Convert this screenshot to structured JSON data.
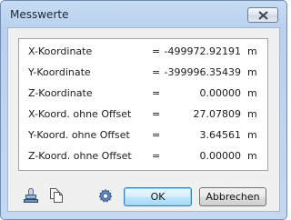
{
  "window": {
    "title": "Messwerte"
  },
  "measurements": [
    {
      "label": "X-Koordinate",
      "eq": "=",
      "value": "-499972.92191",
      "unit": "m"
    },
    {
      "label": "Y-Koordinate",
      "eq": "=",
      "value": "-399996.35439",
      "unit": "m"
    },
    {
      "label": "Z-Koordinate",
      "eq": "=",
      "value": "0.00000",
      "unit": "m"
    },
    {
      "label": "X-Koord. ohne Offset",
      "eq": "=",
      "value": "27.07809",
      "unit": "m"
    },
    {
      "label": "Y-Koord. ohne Offset",
      "eq": "=",
      "value": "3.64561",
      "unit": "m"
    },
    {
      "label": "Z-Koord. ohne Offset",
      "eq": "=",
      "value": "0.00000",
      "unit": "m"
    }
  ],
  "buttons": {
    "ok": "OK",
    "cancel": "Abbrechen"
  },
  "icons": {
    "stamp": "stamp-icon",
    "copy": "copy-icon",
    "settings": "gear-icon",
    "close": "close-icon"
  }
}
